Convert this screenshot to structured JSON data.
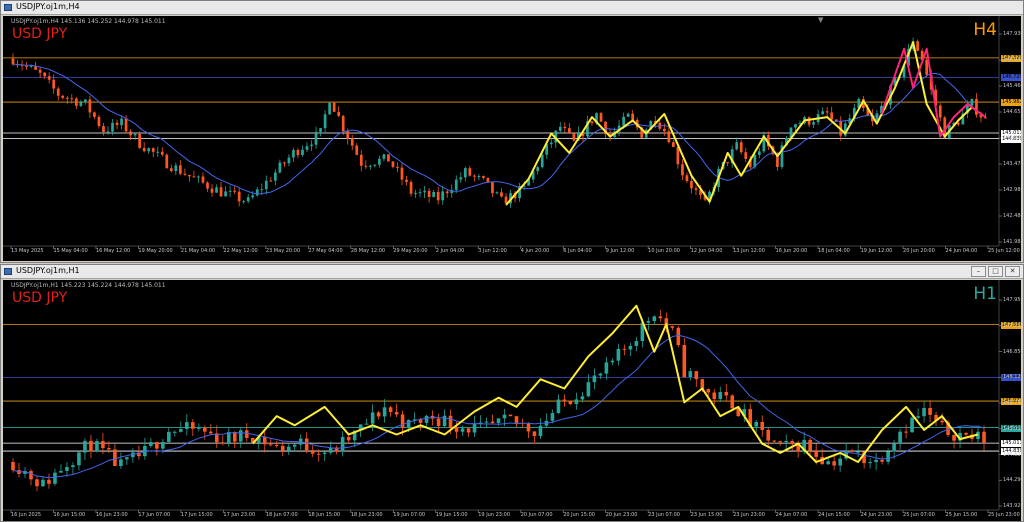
{
  "colors": {
    "bull": "#26a69a",
    "bear": "#ff5722",
    "ma": "#4466ee",
    "zigzag_yellow": "#ffee33",
    "zigzag_pink": "#ff2277",
    "orange_line": "#e8a317",
    "blue_line": "#3850c8",
    "teal_line": "#2aa6a0",
    "white_line": "#ffffff"
  },
  "windows": [
    {
      "title": "USDJPY.oj1m,H4",
      "info": "USDJPY.oj1m,H4  145.136 145.252 144.978 145.011",
      "symbol": "USD JPY",
      "timeframe": "H4",
      "timeframe_color": "#ff9900",
      "y_range": [
        141.6,
        148.3
      ],
      "axis_prices": [
        "147.930",
        "146.940",
        "145.460",
        "144.655",
        "143.970",
        "143.476",
        "142.980",
        "142.480",
        "141.988"
      ],
      "hlines": [
        {
          "price": 147.32,
          "color": "#e8a317",
          "tag": "147.320"
        },
        {
          "price": 146.72,
          "color": "#3850c8",
          "tag": "146.720"
        },
        {
          "price": 145.962,
          "color": "#e8a317",
          "tag": "145.962"
        },
        {
          "price": 145.011,
          "color": "#ffffff",
          "tag": "145.011"
        },
        {
          "price": 144.839,
          "color": "#ffffff",
          "tag": "144.839"
        }
      ],
      "time_labels": [
        "13 May 2025",
        "15 May 04:00",
        "16 May 12:00",
        "19 May 20:00",
        "21 May 04:00",
        "22 May 12:00",
        "23 May 20:00",
        "27 May 04:00",
        "28 May 12:00",
        "29 May 20:00",
        "2 Jun 04:00",
        "3 Jun 12:00",
        "4 Jun 20:00",
        "6 Jun 04:00",
        "9 Jun 12:00",
        "10 Jun 20:00",
        "12 Jun 04:00",
        "13 Jun 12:00",
        "16 Jun 20:00",
        "18 Jun 04:00",
        "19 Jun 12:00",
        "20 Jun 20:00",
        "24 Jun 04:00",
        "25 Jun 12:00"
      ],
      "chart_data": {
        "type": "candlestick",
        "anchors": [
          [
            0,
            147.3
          ],
          [
            6,
            146.8
          ],
          [
            10,
            146.2
          ],
          [
            16,
            145.9
          ],
          [
            20,
            145.1
          ],
          [
            24,
            145.3
          ],
          [
            28,
            144.7
          ],
          [
            34,
            144.1
          ],
          [
            40,
            143.6
          ],
          [
            46,
            143.2
          ],
          [
            52,
            142.9
          ],
          [
            56,
            143.5
          ],
          [
            62,
            144.4
          ],
          [
            68,
            145.0
          ],
          [
            70,
            146.1
          ],
          [
            73,
            145.2
          ],
          [
            77,
            144.1
          ],
          [
            83,
            144.2
          ],
          [
            88,
            143.2
          ],
          [
            94,
            143.0
          ],
          [
            100,
            143.8
          ],
          [
            104,
            143.5
          ],
          [
            108,
            142.9
          ],
          [
            113,
            143.3
          ],
          [
            117,
            144.3
          ],
          [
            121,
            145.2
          ],
          [
            124,
            144.7
          ],
          [
            129,
            145.6
          ],
          [
            132,
            144.9
          ],
          [
            136,
            145.5
          ],
          [
            139,
            145.0
          ],
          [
            142,
            145.5
          ],
          [
            145,
            144.9
          ],
          [
            148,
            143.8
          ],
          [
            153,
            142.8
          ],
          [
            156,
            143.8
          ],
          [
            160,
            144.6
          ],
          [
            163,
            144.0
          ],
          [
            166,
            144.8
          ],
          [
            169,
            144.1
          ],
          [
            172,
            145.3
          ],
          [
            176,
            145.4
          ],
          [
            180,
            145.6
          ],
          [
            183,
            145.0
          ],
          [
            187,
            145.9
          ],
          [
            190,
            145.3
          ],
          [
            194,
            146.3
          ],
          [
            197,
            147.1
          ],
          [
            199,
            147.9
          ],
          [
            201,
            147.3
          ],
          [
            203,
            146.3
          ],
          [
            206,
            145.0
          ],
          [
            209,
            145.4
          ],
          [
            212,
            145.9
          ],
          [
            215,
            145.4
          ]
        ],
        "series": [
          {
            "name": "",
            "points": [
              [
                109,
                142.8
              ],
              [
                114,
                143.6
              ],
              [
                119,
                145.0
              ],
              [
                123,
                144.4
              ],
              [
                128,
                145.5
              ],
              [
                132,
                144.9
              ],
              [
                137,
                145.4
              ],
              [
                140,
                145.0
              ],
              [
                144,
                145.6
              ],
              [
                150,
                143.7
              ],
              [
                154,
                142.9
              ],
              [
                158,
                144.4
              ],
              [
                161,
                143.7
              ],
              [
                166,
                144.9
              ],
              [
                169,
                144.3
              ],
              [
                175,
                145.4
              ],
              [
                180,
                145.5
              ],
              [
                184,
                145.0
              ],
              [
                188,
                146.0
              ],
              [
                191,
                145.3
              ],
              [
                195,
                146.4
              ],
              [
                199,
                147.8
              ],
              [
                202,
                145.9
              ],
              [
                206,
                144.9
              ],
              [
                209,
                145.4
              ],
              [
                212,
                145.8
              ]
            ]
          },
          {
            "name": "",
            "points": [
              [
                192,
                145.6
              ],
              [
                197,
                147.6
              ],
              [
                199,
                146.4
              ],
              [
                202,
                147.6
              ],
              [
                205,
                144.9
              ],
              [
                208,
                145.5
              ],
              [
                211,
                145.9
              ],
              [
                215,
                145.5
              ]
            ]
          }
        ]
      }
    },
    {
      "title": "USDJPY.oj1m,H1",
      "info": "USDJPY.oj1m,H1  145.223 145.224 144.978 145.011",
      "symbol": "USD JPY",
      "timeframe": "H1",
      "timeframe_color": "#2aa6a0",
      "y_range": [
        143.6,
        148.3
      ],
      "axis_prices": [
        "147.950",
        "147.210",
        "146.850",
        "146.120",
        "145.750",
        "145.010",
        "144.630",
        "144.290",
        "143.920"
      ],
      "hlines": [
        {
          "price": 147.59,
          "color": "#e8a317",
          "tag": "147.586"
        },
        {
          "price": 146.44,
          "color": "#3850c8",
          "tag": "146.440"
        },
        {
          "price": 145.927,
          "color": "#e8a317",
          "tag": "145.927"
        },
        {
          "price": 145.35,
          "color": "#2aa6a0",
          "tag": "145.350"
        },
        {
          "price": 145.011,
          "color": "#ffffff",
          "tag": "145.011"
        },
        {
          "price": 144.839,
          "color": "#ffffff",
          "tag": "144.839"
        }
      ],
      "time_labels": [
        "16 Jun 2025",
        "16 Jun 15:00",
        "16 Jun 23:00",
        "17 Jun 07:00",
        "17 Jun 15:00",
        "17 Jun 23:00",
        "18 Jun 07:00",
        "18 Jun 15:00",
        "18 Jun 23:00",
        "19 Jun 07:00",
        "19 Jun 15:00",
        "19 Jun 23:00",
        "20 Jun 07:00",
        "20 Jun 15:00",
        "20 Jun 23:00",
        "23 Jun 07:00",
        "23 Jun 15:00",
        "23 Jun 23:00",
        "24 Jun 07:00",
        "24 Jun 15:00",
        "24 Jun 23:00",
        "25 Jun 07:00",
        "25 Jun 15:00",
        "25 Jun 23:00"
      ],
      "chart_data": {
        "type": "candlestick",
        "anchors": [
          [
            0,
            144.6
          ],
          [
            5,
            144.1
          ],
          [
            9,
            144.6
          ],
          [
            13,
            145.0
          ],
          [
            18,
            144.5
          ],
          [
            22,
            144.8
          ],
          [
            26,
            145.3
          ],
          [
            31,
            145.3
          ],
          [
            35,
            145.1
          ],
          [
            40,
            145.2
          ],
          [
            44,
            144.9
          ],
          [
            48,
            145.0
          ],
          [
            53,
            144.8
          ],
          [
            57,
            145.2
          ],
          [
            62,
            145.8
          ],
          [
            66,
            145.4
          ],
          [
            70,
            145.6
          ],
          [
            74,
            145.4
          ],
          [
            78,
            145.3
          ],
          [
            83,
            145.5
          ],
          [
            87,
            145.3
          ],
          [
            91,
            145.8
          ],
          [
            95,
            146.2
          ],
          [
            99,
            146.6
          ],
          [
            103,
            147.2
          ],
          [
            107,
            147.9
          ],
          [
            110,
            147.4
          ],
          [
            112,
            146.6
          ],
          [
            116,
            146.1
          ],
          [
            120,
            145.9
          ],
          [
            124,
            145.3
          ],
          [
            128,
            144.9
          ],
          [
            132,
            145.0
          ],
          [
            136,
            144.6
          ],
          [
            140,
            144.8
          ],
          [
            144,
            144.6
          ],
          [
            148,
            145.3
          ],
          [
            152,
            145.7
          ],
          [
            155,
            145.3
          ],
          [
            158,
            145.2
          ],
          [
            162,
            145.1
          ]
        ],
        "series": [
          {
            "name": "",
            "points": [
              [
                40,
                145.0
              ],
              [
                44,
                145.6
              ],
              [
                47,
                145.4
              ],
              [
                52,
                145.8
              ],
              [
                56,
                145.2
              ],
              [
                60,
                145.4
              ],
              [
                64,
                145.2
              ],
              [
                68,
                145.4
              ],
              [
                72,
                145.2
              ],
              [
                77,
                145.7
              ],
              [
                81,
                146.0
              ],
              [
                84,
                145.8
              ],
              [
                88,
                146.4
              ],
              [
                92,
                146.2
              ],
              [
                96,
                146.9
              ],
              [
                100,
                147.4
              ],
              [
                104,
                148.0
              ],
              [
                107,
                147.0
              ],
              [
                109,
                147.6
              ],
              [
                112,
                145.9
              ],
              [
                115,
                146.2
              ],
              [
                118,
                145.6
              ],
              [
                121,
                145.8
              ],
              [
                125,
                145.0
              ],
              [
                128,
                144.8
              ],
              [
                131,
                145.0
              ],
              [
                134,
                144.6
              ],
              [
                138,
                144.8
              ],
              [
                141,
                144.6
              ],
              [
                145,
                145.3
              ],
              [
                149,
                145.8
              ],
              [
                152,
                145.3
              ],
              [
                155,
                145.6
              ],
              [
                158,
                145.1
              ],
              [
                161,
                145.2
              ]
            ]
          }
        ]
      }
    }
  ]
}
